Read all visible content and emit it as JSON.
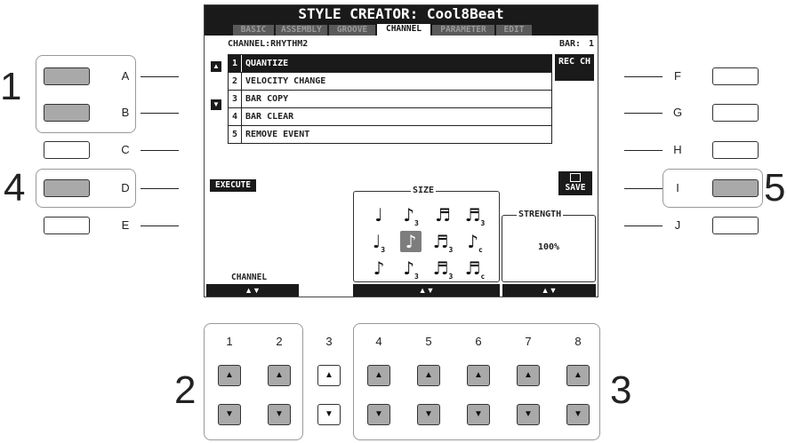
{
  "screen": {
    "title": "STYLE CREATOR: Cool8Beat",
    "tabs": [
      "BASIC",
      "ASSEMBLY",
      "GROOVE",
      "CHANNEL",
      "PARAMETER",
      "EDIT"
    ],
    "active_tab": "CHANNEL",
    "channel_label": "CHANNEL:RHYTHM2",
    "bar_label": "BAR:",
    "bar_value": "1",
    "menu_items": [
      {
        "num": "1",
        "label": "QUANTIZE",
        "selected": true
      },
      {
        "num": "2",
        "label": "VELOCITY CHANGE",
        "selected": false
      },
      {
        "num": "3",
        "label": "BAR COPY",
        "selected": false
      },
      {
        "num": "4",
        "label": "BAR CLEAR",
        "selected": false
      },
      {
        "num": "5",
        "label": "REMOVE EVENT",
        "selected": false
      }
    ],
    "rec_ch": "REC CH",
    "execute": "EXECUTE",
    "save": "SAVE",
    "size_title": "SIZE",
    "strength_title": "STRENGTH",
    "strength_value": "100%",
    "channel_bottom": "CHANNEL",
    "up_down": "▲▼"
  },
  "left_buttons": [
    "A",
    "B",
    "C",
    "D",
    "E"
  ],
  "right_buttons": [
    "F",
    "G",
    "H",
    "I",
    "J"
  ],
  "callouts": {
    "left_top": "1",
    "left_bottom": "4",
    "right": "5",
    "bottom_left": "2",
    "bottom_right": "3"
  },
  "bottom_buttons": [
    "1",
    "2",
    "3",
    "4",
    "5",
    "6",
    "7",
    "8"
  ],
  "icons": {
    "up": "▲",
    "down": "▼"
  }
}
